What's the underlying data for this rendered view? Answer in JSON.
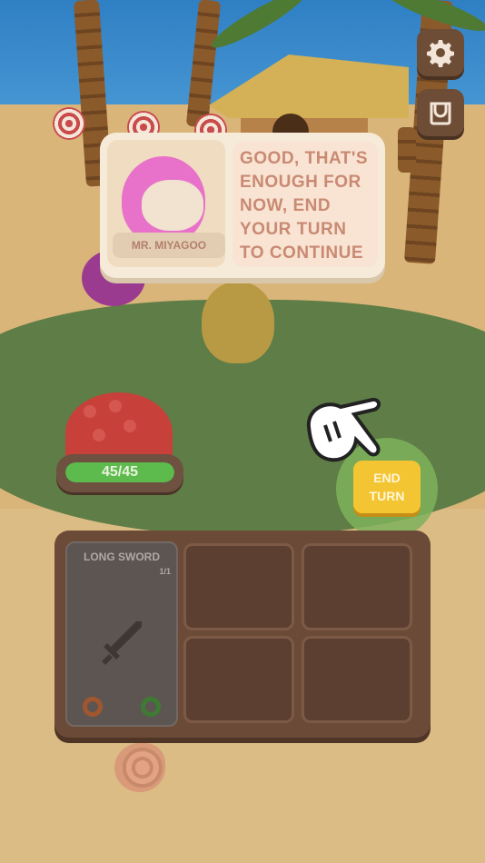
{
  "dialog": {
    "speaker": "MR. MIYAGOO",
    "message": "GOOD, THAT'S ENOUGH FOR NOW, END YOUR TURN TO CONTINUE"
  },
  "player": {
    "hp_text": "45/45",
    "hp_fraction": 1.0
  },
  "actions": {
    "end_turn_line1": "END",
    "end_turn_line2": "TURN"
  },
  "inventory": {
    "card": {
      "title": "LONG SWORD",
      "count": "1/1",
      "icon": "sword-icon"
    },
    "empty_slots": 4
  },
  "top_right_buttons": [
    "gear-icon",
    "bag-icon"
  ],
  "colors": {
    "hp_fill": "#5dbb4d",
    "end_turn": "#f4c532",
    "dialog_bg": "#f6ead8",
    "dialog_text": "#c98a73"
  }
}
